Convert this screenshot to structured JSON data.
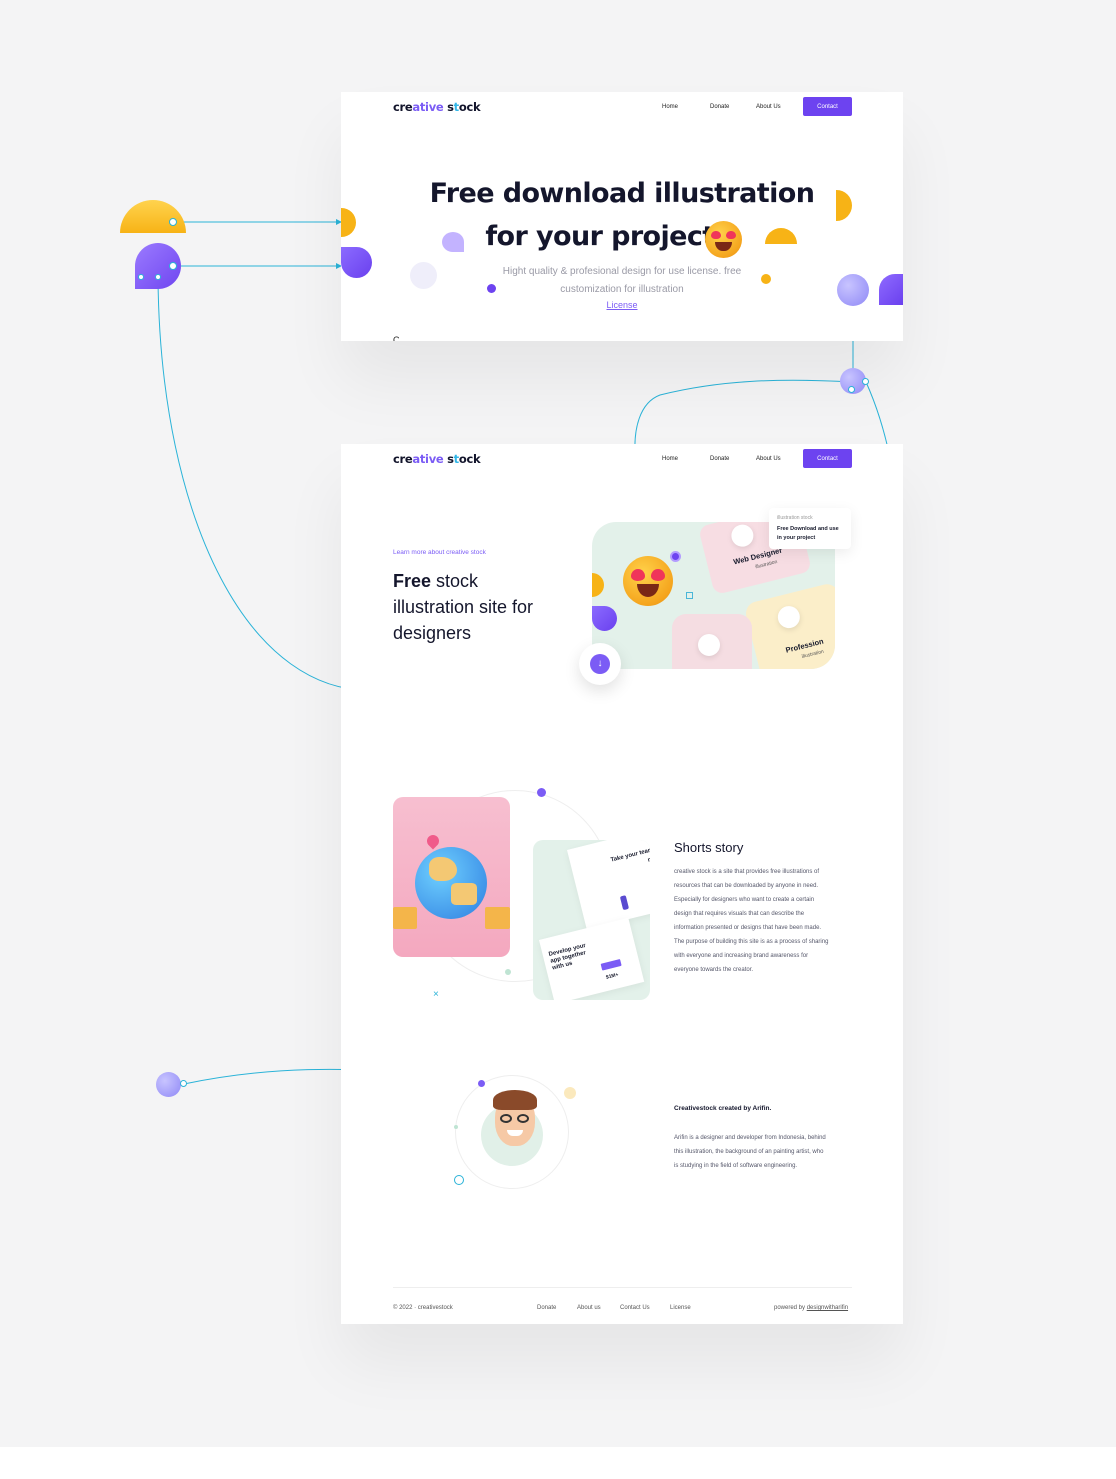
{
  "brand": {
    "logo_part1": "cre",
    "logo_part2": "ative",
    "logo_part3": " s",
    "logo_part4": "t",
    "logo_part5": "ock",
    "accent": "#6d43f0"
  },
  "nav": {
    "home": "Home",
    "donate": "Donate",
    "about": "About Us",
    "contact": "Contact"
  },
  "hero": {
    "title_line1": "Free download illustration",
    "title_line2": "for your project",
    "subtitle_line1": "Hight quality & profesional design for use license. free",
    "subtitle_line2": "customization for illustration",
    "license": "License",
    "cut_text": "C"
  },
  "intro": {
    "kicker": "Learn more about creative stock",
    "title_bold": "Free",
    "title_rest1": " stock",
    "title_line2": "illustration site for",
    "title_line3": "designers",
    "tooltip_small": "illustration stock",
    "tooltip_line1": "Free Download and use",
    "tooltip_line2": "in your project",
    "card1_title": "Web Designer",
    "card1_sub": "illustration",
    "card2_title": "Profession",
    "card2_sub": "illustration"
  },
  "story": {
    "title": "Shorts story",
    "lines": [
      "creative stock is a site that provides free illustrations of",
      "resources that can be downloaded by anyone in need.",
      "Especially for designers who want to create a certain",
      "design that requires visuals that can describe the",
      "information presented or designs that have been made.",
      "The purpose of building this site is as a process of sharing",
      "with everyone and increasing brand awareness for",
      "everyone towards the creator."
    ],
    "mock_title1": "Take your team",
    "mock_title2": "ne",
    "mock_dev1": "Develop your",
    "mock_dev2": "app together",
    "mock_dev3": "with us",
    "mock_stat": "$1M+"
  },
  "creator": {
    "title": "Creativestock created by Arifin.",
    "lines": [
      "Arifin is a designer and developer from Indonesia, behind",
      "this illustration, the background of an painting artist, who",
      "is studying in the field of software engineering."
    ]
  },
  "footer": {
    "copyright": "© 2022 · creativestock",
    "links": [
      "Donate",
      "About us",
      "Contact Us",
      "License"
    ],
    "powered_prefix": "powered by ",
    "powered_link": "designwitharifin"
  }
}
